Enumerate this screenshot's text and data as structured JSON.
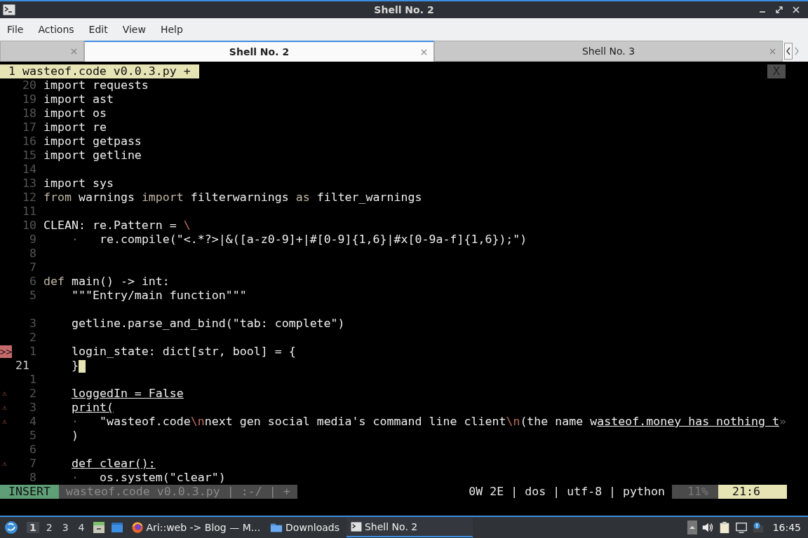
{
  "window": {
    "title": "Shell No. 2"
  },
  "menu": [
    "File",
    "Actions",
    "Edit",
    "View",
    "Help"
  ],
  "tabs": [
    {
      "selected": false
    },
    {
      "label": "Shell No. 2",
      "selected": true
    },
    {
      "label": "Shell No. 3",
      "selected": false
    }
  ],
  "editor": {
    "buffer_tab": "1 wasteof.code v0.0.3.py +",
    "close_label": "X",
    "lines": [
      {
        "number": "20",
        "segments": [
          {
            "text": "import requests",
            "kind": "plain"
          }
        ]
      },
      {
        "number": "19",
        "segments": [
          {
            "text": "import ast",
            "kind": "plain"
          }
        ]
      },
      {
        "number": "18",
        "segments": [
          {
            "text": "import os",
            "kind": "plain"
          }
        ]
      },
      {
        "number": "17",
        "segments": [
          {
            "text": "import re",
            "kind": "plain"
          }
        ]
      },
      {
        "number": "16",
        "segments": [
          {
            "text": "import getpass",
            "kind": "plain"
          }
        ]
      },
      {
        "number": "15",
        "segments": [
          {
            "text": "import getline",
            "kind": "plain"
          }
        ]
      },
      {
        "number": "14"
      },
      {
        "number": "13",
        "segments": [
          {
            "text": "import sys",
            "kind": "plain"
          }
        ]
      },
      {
        "number": "12",
        "segments": [
          {
            "text": "from",
            "kind": "keyword"
          },
          {
            "text": " warnings ",
            "kind": "plain"
          },
          {
            "text": "import",
            "kind": "keyword"
          },
          {
            "text": " filterwarnings ",
            "kind": "plain"
          },
          {
            "text": "as",
            "kind": "keyword"
          },
          {
            "text": " filter_warnings",
            "kind": "plain"
          }
        ]
      },
      {
        "number": "11"
      },
      {
        "number": "10",
        "segments": [
          {
            "text": "CLEAN: re.Pattern = ",
            "kind": "plain"
          },
          {
            "text": "\\",
            "kind": "escape"
          }
        ]
      },
      {
        "number": "9",
        "segments": [
          {
            "text": "    ·   ",
            "kind": "dim"
          },
          {
            "text": "re.compile(\"<.*?>|&([a-z0-9]+|#[0-9]{1,6}|#x[0-9a-f]{1,6});\")",
            "kind": "plain"
          }
        ]
      },
      {
        "number": "8"
      },
      {
        "number": "7"
      },
      {
        "number": "6",
        "segments": [
          {
            "text": "def",
            "kind": "keyword"
          },
          {
            "text": " main() -> int:",
            "kind": "plain"
          }
        ]
      },
      {
        "number": "5",
        "segments": [
          {
            "text": "    \"\"\"Entry/main function\"\"\"",
            "kind": "plain"
          }
        ]
      },
      {
        "number": "3",
        "blank_row_before": true,
        "segments": [
          {
            "text": "    getline.parse_and_bind(\"tab: complete\")",
            "kind": "plain"
          }
        ]
      },
      {
        "number": "2"
      },
      {
        "number": "1",
        "sign": {
          "kind": "error",
          "text": ">>"
        },
        "segments": [
          {
            "text": "    login_state: dict[str, bool] = {",
            "kind": "plain"
          }
        ]
      },
      {
        "number": "21",
        "current": true,
        "segments": [
          {
            "text": "    }",
            "kind": "plain"
          },
          {
            "kind": "cursor"
          }
        ]
      },
      {
        "number": "1"
      },
      {
        "number": "2",
        "indented": true,
        "sign": {
          "kind": "warning",
          "text": "⚠"
        },
        "segments": [
          {
            "text": "loggedIn = False",
            "kind": "underline"
          }
        ]
      },
      {
        "number": "3",
        "indented": true,
        "sign": {
          "kind": "warning",
          "text": "⚠"
        },
        "segments": [
          {
            "text": "print(",
            "kind": "underline"
          }
        ]
      },
      {
        "number": "4",
        "sign": {
          "kind": "warning",
          "text": "⚠"
        },
        "segments": [
          {
            "text": "    ·   ",
            "kind": "dim"
          },
          {
            "text": "\"wasteof.code",
            "kind": "plain"
          },
          {
            "text": "\\n",
            "kind": "escape"
          },
          {
            "text": "next gen social media's command line client",
            "kind": "plain"
          },
          {
            "text": "\\n",
            "kind": "escape"
          },
          {
            "text": "(the name w",
            "kind": "plain"
          },
          {
            "text": "asteof.money has nothing t",
            "kind": "underline"
          },
          {
            "text": "»",
            "kind": "dim"
          }
        ]
      },
      {
        "number": "5",
        "segments": [
          {
            "text": "    )",
            "kind": "plain"
          }
        ]
      },
      {
        "number": "6"
      },
      {
        "number": "7",
        "indented": true,
        "sign": {
          "kind": "warning",
          "text": "⚠"
        },
        "segments": [
          {
            "text": "def clear():",
            "kind": "underline"
          }
        ]
      },
      {
        "number": "8",
        "segments": [
          {
            "text": "    ·   ",
            "kind": "dim"
          },
          {
            "text": "os.system(\"clear\")",
            "kind": "plain"
          }
        ]
      }
    ],
    "status": {
      "mode": "INSERT",
      "file": "wasteof.code v0.0.3.py | :-/ | +",
      "info": "0W 2E | dos | utf-8 | python",
      "percent": "11%",
      "position": "21:6"
    }
  },
  "taskbar": {
    "desktops": [
      {
        "label": "1",
        "selected": true
      },
      {
        "label": "2",
        "selected": false
      },
      {
        "label": "3",
        "selected": false
      },
      {
        "label": "4",
        "selected": false
      }
    ],
    "tasks": [
      {
        "kind": "browser",
        "label": "Ari::web -> Blog — M...",
        "selected": false
      },
      {
        "kind": "folder",
        "label": "Downloads",
        "selected": false
      },
      {
        "kind": "terminal",
        "label": "Shell No. 2",
        "selected": true
      }
    ],
    "clock": "16:45"
  }
}
